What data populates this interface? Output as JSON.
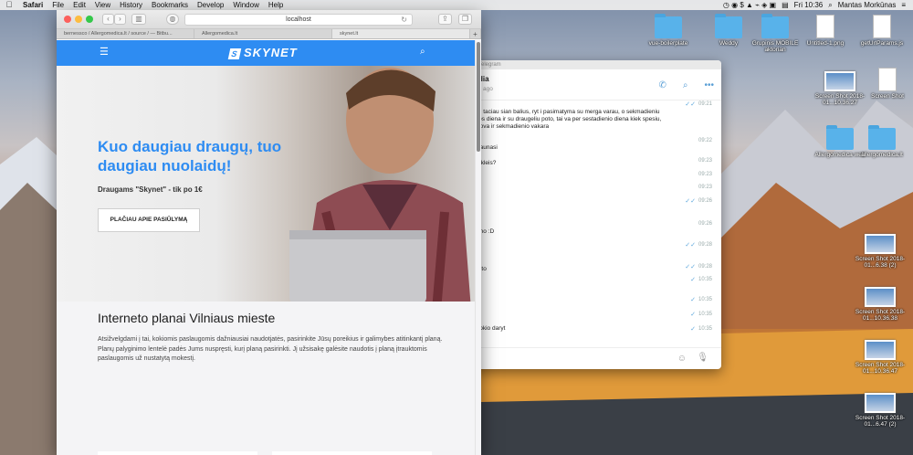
{
  "menubar": {
    "app": "Safari",
    "menus": [
      "File",
      "Edit",
      "View",
      "History",
      "Bookmarks",
      "Develop",
      "Window",
      "Help"
    ],
    "flag_icon": "us-flag-icon",
    "clock": "Fri 10:36",
    "user": "Mantas Morkūnas"
  },
  "safari": {
    "url": "localhost",
    "tabs": [
      "bernessco / Allergomedica.lt / source / — Bitbu...",
      "Allergomedica.lt",
      "skynet.lt"
    ],
    "plus": "+"
  },
  "site": {
    "logo": "SKYNET",
    "hero_title": "Kuo daugiau draugų, tuo daugiau nuolaidų!",
    "hero_sub": "Draugams \"Skynet\" - tik po 1€",
    "cta": "PLAČIAU APIE PASIŪLYMĄ",
    "plans_title": "Interneto planai Vilniaus mieste",
    "plans_text": "Atsižvelgdami į tai, kokiomis paslaugomis dažniausiai naudotjatės, pasirinkite Jūsų poreikius ir galimybes atitinkantį planą. Planų palyginimo lentelė padės Jums nuspręsti, kurį planą pasirinkti. Jį užsisakę galėsite naudotis į planą įtrauktomis paslaugomis už nustatytą mokestį."
  },
  "telegram": {
    "title": "Telegram",
    "chat_name": "dia",
    "status": "s ago",
    "messages": [
      {
        "text": "",
        "time": "09:21",
        "check": true
      },
      {
        "text": "e, taciau sian balius, ryt i pasimatyma su merga varau, o sekmadieniu ros diena ir su draugeliu poto, tai va per sestadienio diena kiek spesiu, uova ir sekmadienio vakara",
        "time": "",
        "check": false
      },
      {
        "text": "",
        "time": "09:22",
        "check": false
      },
      {
        "text": "gaunasi",
        "time": "",
        "check": false
      },
      {
        "text": "iskleis?",
        "time": "09:23",
        "check": false
      },
      {
        "text": "",
        "time": "09:23",
        "check": false
      },
      {
        "text": "",
        "time": "09:23",
        "check": false
      },
      {
        "text": "",
        "time": "09:26",
        "check": true
      },
      {
        "text": "",
        "time": "09:26",
        "check": false
      },
      {
        "text": "ono :D",
        "time": "",
        "check": false
      },
      {
        "text": "",
        "time": "09:28",
        "check": true
      },
      {
        "text": "",
        "time": "09:28",
        "check": true
      },
      {
        "text": "u to",
        "time": "10:35",
        "check": true
      },
      {
        "text": "",
        "time": "10:35",
        "check": true
      },
      {
        "text": "",
        "time": "10:35",
        "check": true
      },
      {
        "text": "itokio daryt",
        "time": "10:35",
        "check": true
      }
    ]
  },
  "desktop": {
    "icons": [
      {
        "label": "vue-boilerplate",
        "kind": "folder"
      },
      {
        "label": "Weddy",
        "kind": "folder"
      },
      {
        "label": "Grupinis MOBILE aktorian",
        "kind": "folder"
      },
      {
        "label": "Untitled-1.png",
        "kind": "doc"
      },
      {
        "label": "getUrlParams.js",
        "kind": "doc"
      },
      {
        "label": "Screen Shot 2018-01...10.36.27",
        "kind": "shot"
      },
      {
        "label": "Screen Shot",
        "kind": "shot"
      },
      {
        "label": "Allergomedica web",
        "kind": "folder"
      },
      {
        "label": "allergomedica.lt",
        "kind": "folder"
      },
      {
        "label": "Screen Shot 2018-01...6.38 (2)",
        "kind": "shot"
      },
      {
        "label": "Screen Shot 2018-01...10.36.38",
        "kind": "shot"
      },
      {
        "label": "Screen Shot 2018-01...10.36.47",
        "kind": "shot"
      },
      {
        "label": "Screen Shot 2018-01...6.47 (2)",
        "kind": "shot"
      }
    ]
  }
}
